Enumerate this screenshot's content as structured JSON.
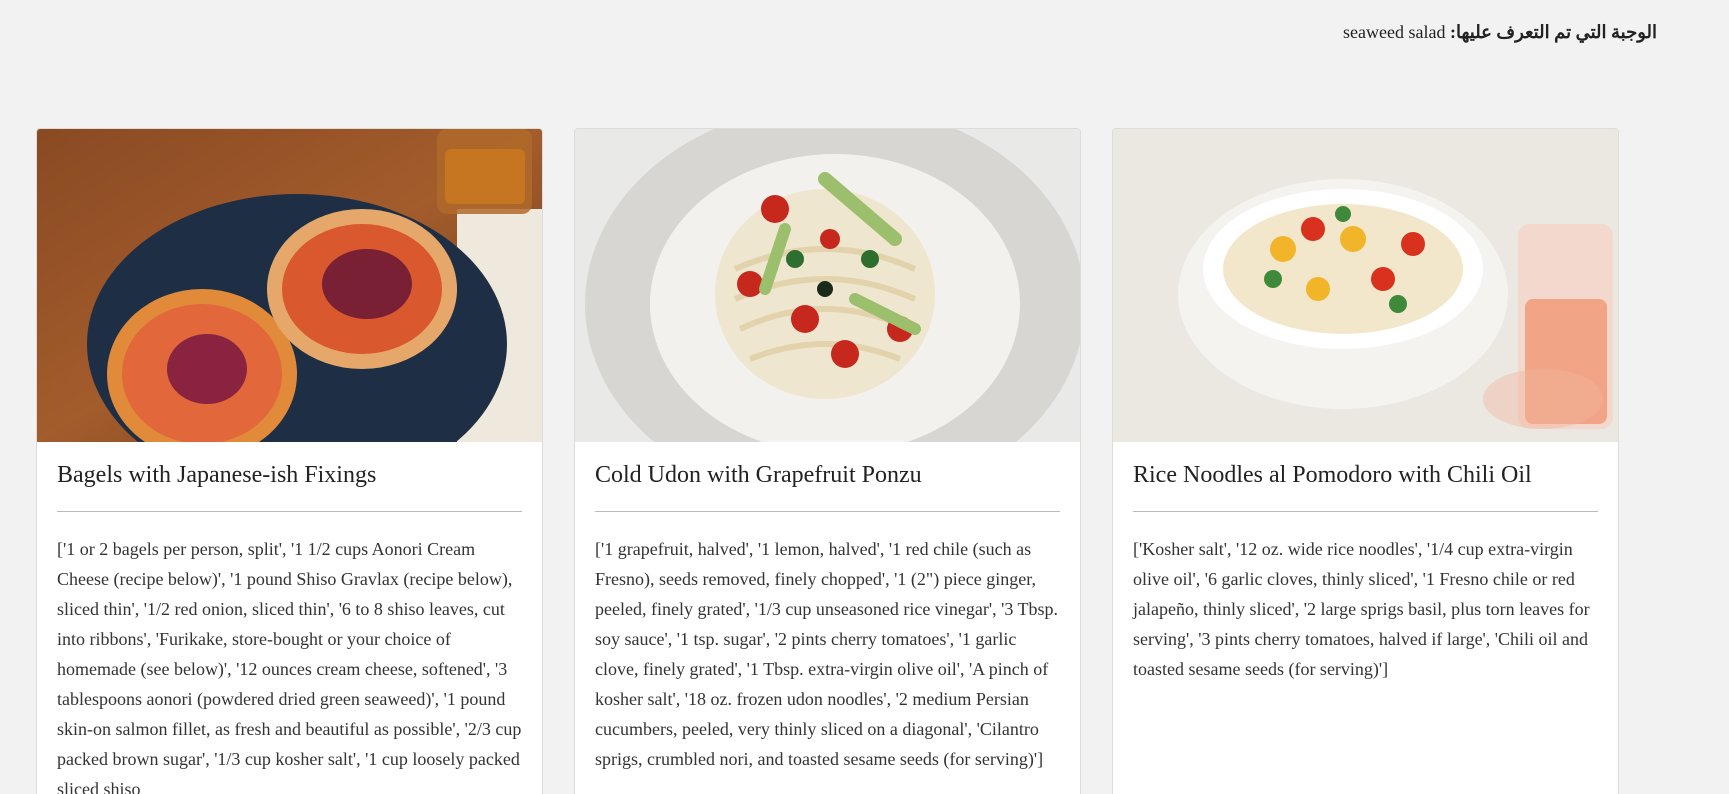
{
  "header": {
    "detected_label": "الوجبة التي تم التعرف عليها:",
    "detected_value": "seaweed salad"
  },
  "cards": [
    {
      "title": "Bagels with Japanese-ish Fixings",
      "ingredients": "['1 or 2 bagels per person, split', '1 1/2 cups Aonori Cream Cheese (recipe below)', '1 pound Shiso Gravlax (recipe below), sliced thin', '1/2 red onion, sliced thin', '6 to 8 shiso leaves, cut into ribbons', 'Furikake, store-bought or your choice of homemade (see below)', '12 ounces cream cheese, softened', '3 tablespoons aonori (powdered dried green seaweed)', '1 pound skin-on salmon fillet, as fresh and beautiful as possible', '2/3 cup packed brown sugar', '1/3 cup kosher salt', '1 cup loosely packed sliced shiso"
    },
    {
      "title": "Cold Udon with Grapefruit Ponzu",
      "ingredients": "['1 grapefruit, halved', '1 lemon, halved', '1 red chile (such as Fresno), seeds removed, finely chopped', '1 (2\") piece ginger, peeled, finely grated', '1/3 cup unseasoned rice vinegar', '3 Tbsp. soy sauce', '1 tsp. sugar', '2 pints cherry tomatoes', '1 garlic clove, finely grated', '1 Tbsp. extra-virgin olive oil', 'A pinch of kosher salt', '18 oz. frozen udon noodles', '2 medium Persian cucumbers, peeled, very thinly sliced on a diagonal', 'Cilantro sprigs, crumbled nori, and toasted sesame seeds (for serving)']"
    },
    {
      "title": "Rice Noodles al Pomodoro with Chili Oil",
      "ingredients": "['Kosher salt', '12 oz. wide rice noodles', '1/4 cup extra-virgin olive oil', '6 garlic cloves, thinly sliced', '1 Fresno chile or red jalapeño, thinly sliced', '2 large sprigs basil, plus torn leaves for serving', '3 pints cherry tomatoes, halved if large', 'Chili oil and toasted sesame seeds (for serving)']"
    }
  ]
}
